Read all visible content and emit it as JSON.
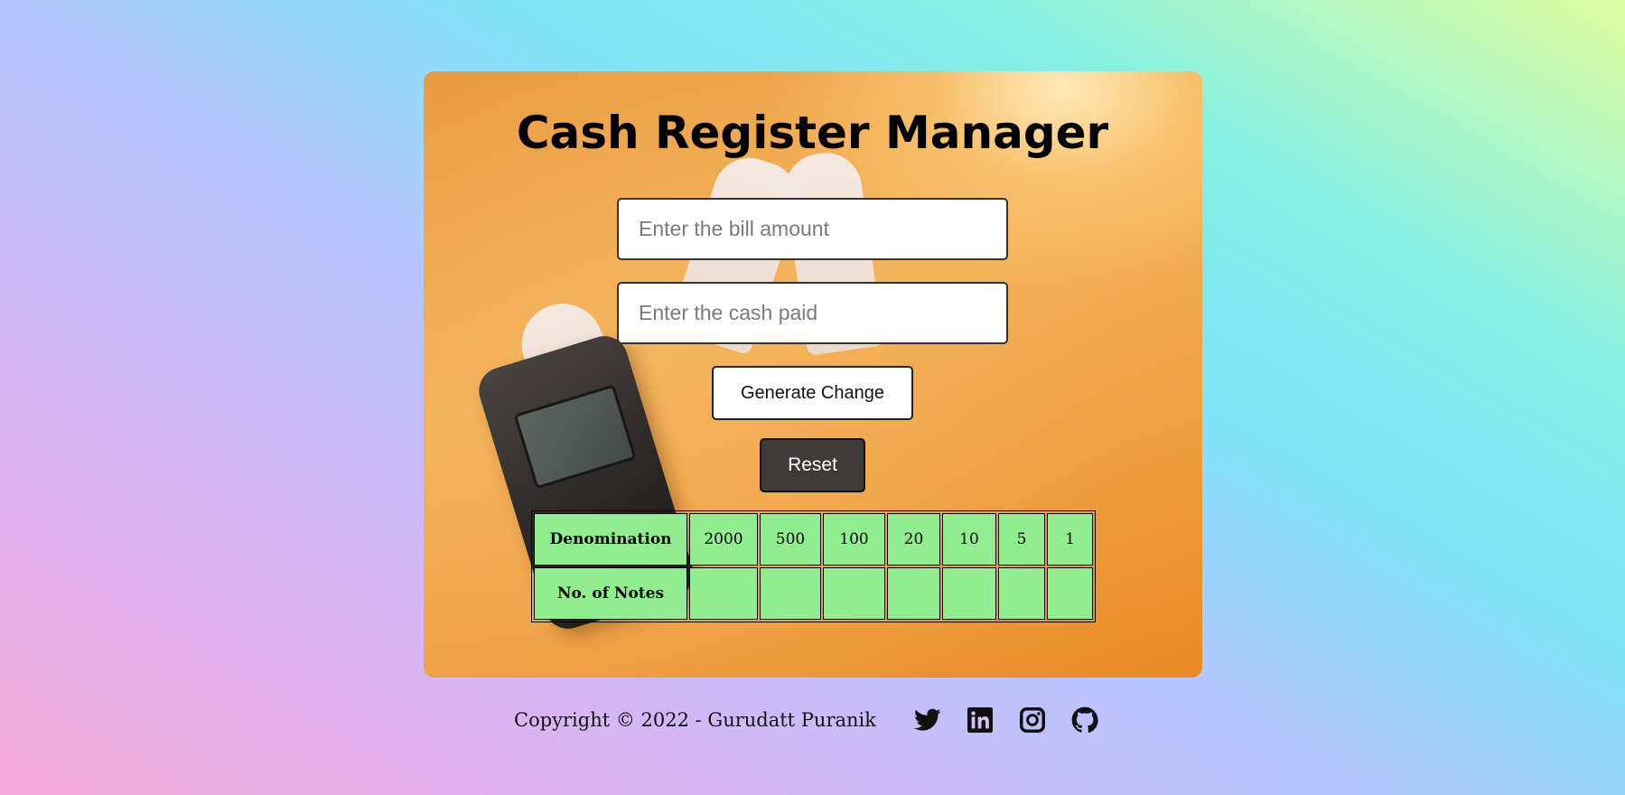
{
  "app": {
    "title": "Cash Register Manager"
  },
  "form": {
    "bill_placeholder": "Enter the bill amount",
    "bill_value": "",
    "cash_placeholder": "Enter the cash paid",
    "cash_value": "",
    "generate_label": "Generate Change",
    "reset_label": "Reset"
  },
  "table": {
    "row_headers": [
      "Denomination",
      "No. of Notes"
    ],
    "denominations": [
      "2000",
      "500",
      "100",
      "20",
      "10",
      "5",
      "1"
    ],
    "notes": [
      "",
      "",
      "",
      "",
      "",
      "",
      ""
    ]
  },
  "footer": {
    "copyright": "Copyright © 2022 - Gurudatt Puranik",
    "social": [
      {
        "name": "twitter",
        "icon": "twitter-icon"
      },
      {
        "name": "linkedin",
        "icon": "linkedin-icon"
      },
      {
        "name": "instagram",
        "icon": "instagram-icon"
      },
      {
        "name": "github",
        "icon": "github-icon"
      }
    ]
  },
  "colors": {
    "table_cell": "#90ee90",
    "reset_button": "#3e3a38",
    "card_orange": "#eea042"
  }
}
